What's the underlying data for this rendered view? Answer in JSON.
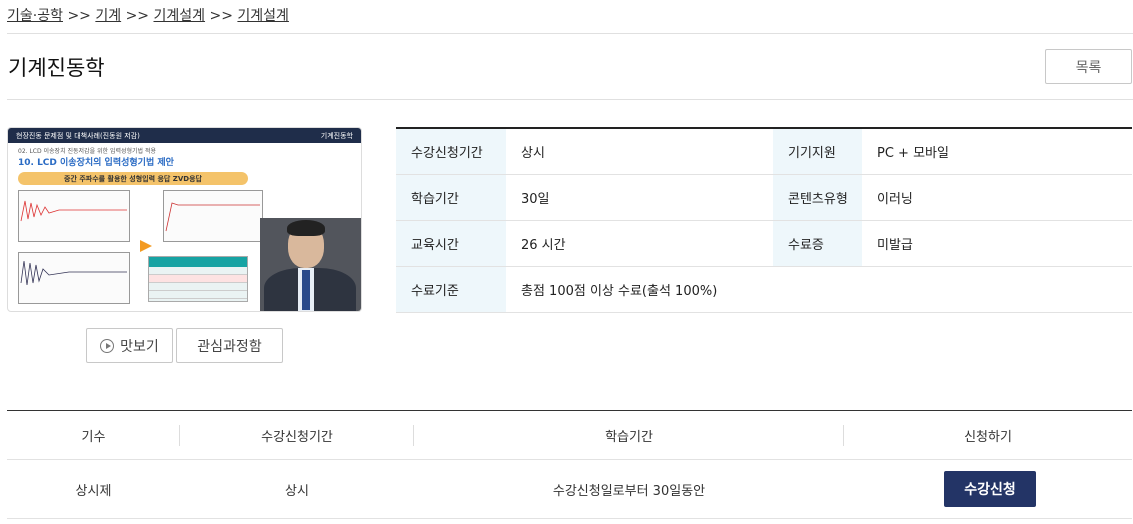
{
  "breadcrumb": [
    "기술·공학",
    "기계",
    "기계설계",
    "기계설계"
  ],
  "breadcrumb_sep": ">>",
  "title": "기계진동학",
  "list_button": "목록",
  "thumbnail": {
    "bar_title": "현장진동 문제점 및 대책사례(진동원 저감)",
    "bar_right": "기계진동학",
    "subtitle": "02. LCD 이송장치 진동저감을 위한 입력성형기법 적용",
    "heading": "10. LCD 이송장치의 입력성형기법 제안",
    "banner": "중간 주파수를 활용한 성형입력 응답 ZVD응답"
  },
  "buttons": {
    "preview": "맛보기",
    "wishlist": "관심과정함"
  },
  "info": [
    {
      "label": "수강신청기간",
      "value": "상시",
      "label2": "기기지원",
      "value2": "PC + 모바일"
    },
    {
      "label": "학습기간",
      "value": "30일",
      "label2": "콘텐츠유형",
      "value2": "이러닝"
    },
    {
      "label": "교육시간",
      "value": "26 시간",
      "label2": "수료증",
      "value2": "미발급"
    },
    {
      "label": "수료기준",
      "value": "총점 100점 이상 수료(출석 100%)"
    }
  ],
  "schedule": {
    "headers": [
      "기수",
      "수강신청기간",
      "학습기간",
      "신청하기"
    ],
    "row": {
      "term": "상시제",
      "period": "상시",
      "study": "수강신청일로부터 30일동안",
      "apply": "수강신청"
    }
  }
}
